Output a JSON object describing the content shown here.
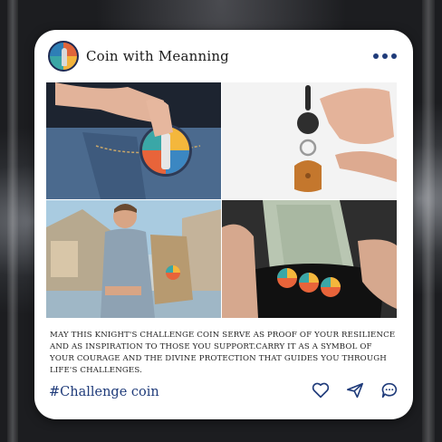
{
  "post": {
    "account_name": "Coin with Meanning",
    "caption": "MAY THIS KNIGHT'S CHALLENGE COIN SERVE AS PROOF OF YOUR RESILIENCE AND AS INSPIRATION TO THOSE YOU SUPPORT.CARRY IT AS A SYMBOL OF YOUR COURAGE AND THE DIVINE PROTECTION THAT GUIDES YOU THROUGH LIFE'S CHALLENGES.",
    "hashtag": "#Challenge coin",
    "photos": [
      "coin-in-jeans-pocket",
      "coin-keychain",
      "man-with-backpack-coin",
      "coins-in-wallet"
    ],
    "icons": [
      "more-icon",
      "heart-icon",
      "send-icon",
      "comment-icon"
    ]
  },
  "colors": {
    "accent": "#1f3b7a",
    "card": "#ffffff"
  }
}
